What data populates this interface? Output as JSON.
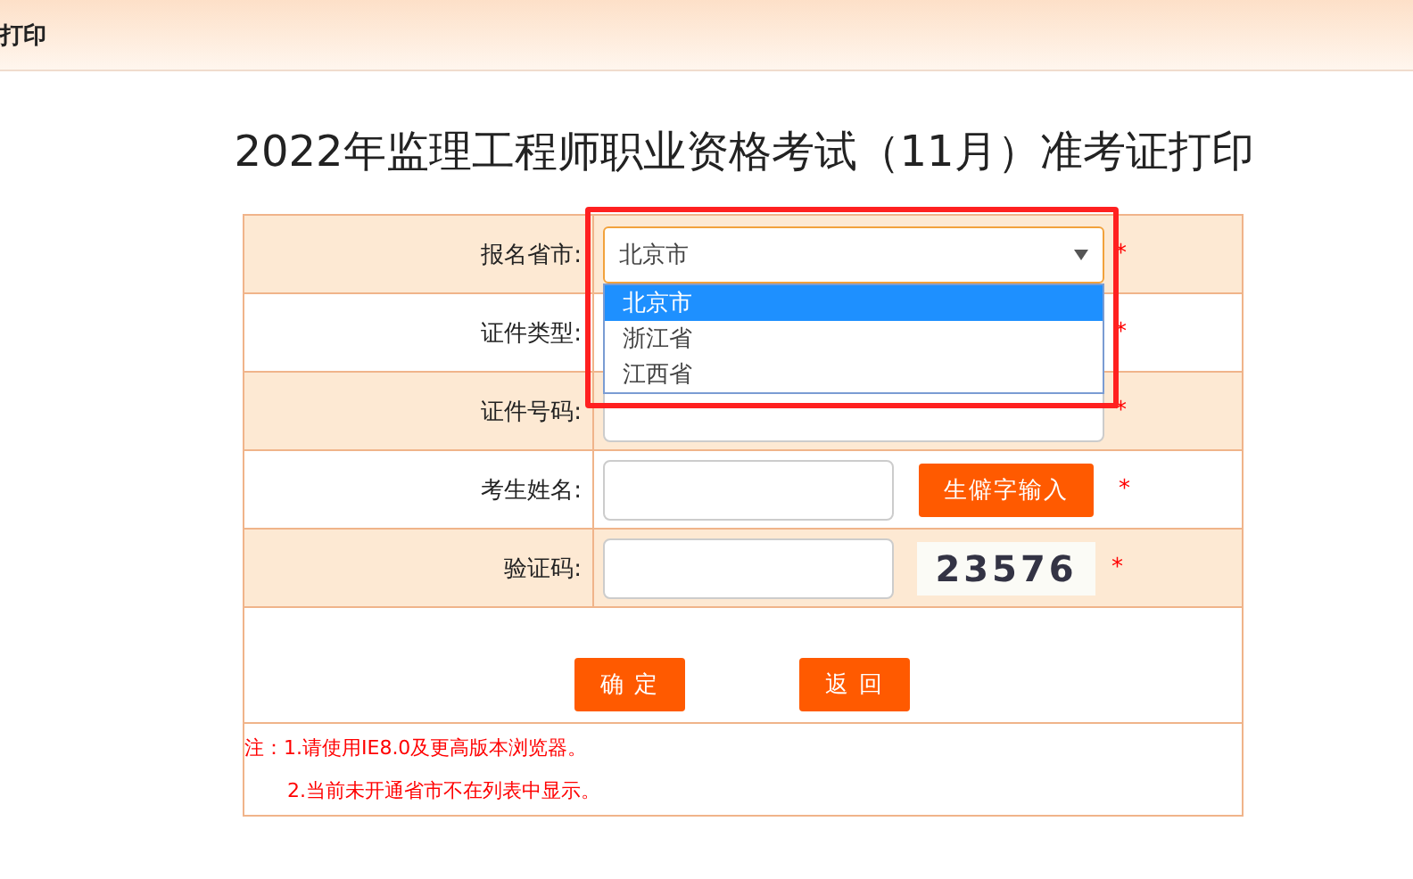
{
  "header": {
    "title": "打印"
  },
  "page_title": "2022年监理工程师职业资格考试（11月）准考证打印",
  "form": {
    "highlight_box": true,
    "rows": [
      {
        "kind": "select",
        "label": "报名省市:",
        "value": "北京市",
        "mark": "*",
        "dropdown": {
          "open": true,
          "options": [
            {
              "label": "北京市",
              "selected": true
            },
            {
              "label": "浙江省",
              "selected": false
            },
            {
              "label": "江西省",
              "selected": false
            }
          ]
        }
      },
      {
        "kind": "covered",
        "label": "证件类型:",
        "mark": "*"
      },
      {
        "kind": "text",
        "label": "证件号码:",
        "mark": "*"
      },
      {
        "kind": "text_button",
        "label": "考生姓名:",
        "button": "生僻字输入",
        "mark": "*"
      },
      {
        "kind": "captcha",
        "label": "验证码:",
        "captcha": "23576",
        "mark": "*"
      }
    ],
    "buttons": [
      "确 定",
      "返 回"
    ],
    "notes": [
      "注：1.请使用IE8.0及更高版本浏览器。",
      "2.当前未开通省市不在列表中显示。"
    ]
  }
}
